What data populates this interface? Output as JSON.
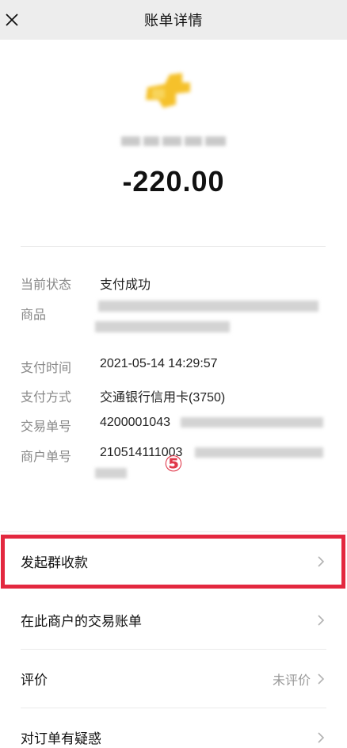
{
  "topbar": {
    "title": "账单详情",
    "close_icon": "close-icon"
  },
  "main": {
    "amount": "-220.00",
    "fields": [
      {
        "key": "当前状态",
        "value": "支付成功"
      },
      {
        "key": "商品",
        "value": ""
      },
      {
        "key": "支付时间",
        "value": "2021-05-14 14:29:57"
      },
      {
        "key": "支付方式",
        "value": "交通银行信用卡(3750)"
      },
      {
        "key": "交易单号",
        "value": "4200001043"
      },
      {
        "key": "商户单号",
        "value": "210514111003"
      }
    ],
    "annotation": "⑤"
  },
  "actions": [
    {
      "label": "发起群收款"
    },
    {
      "label": "在此商户的交易账单"
    },
    {
      "label": "评价",
      "value": "未评价"
    },
    {
      "label": "对订单有疑惑"
    }
  ],
  "colors": {
    "highlight": "#e3283f",
    "annotation": "#e0384a",
    "logo": "#f5c12b"
  }
}
